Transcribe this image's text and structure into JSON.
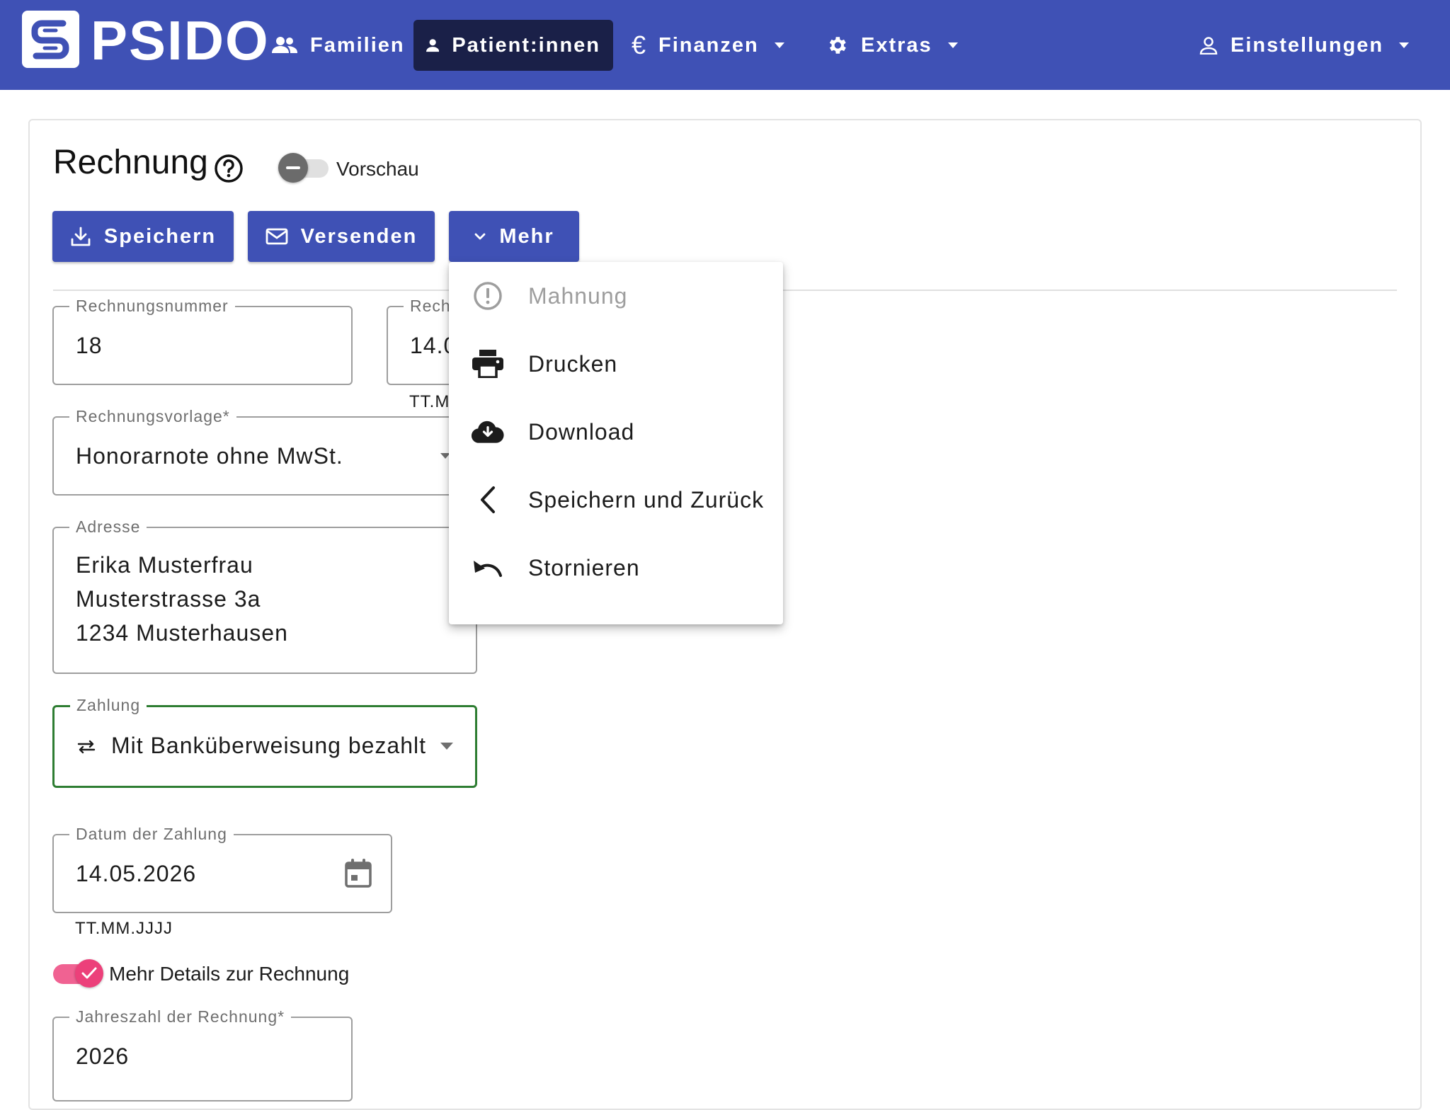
{
  "app": {
    "logo_text": "PSIDO",
    "brand_color": "#3f51b5"
  },
  "nav": {
    "familien": "Familien",
    "patientinnen": "Patient:innen",
    "finanzen": "Finanzen",
    "extras": "Extras",
    "einstellungen": "Einstellungen"
  },
  "page": {
    "title": "Rechnung",
    "preview_label": "Vorschau",
    "buttons": {
      "save": "Speichern",
      "send": "Versenden",
      "more": "Mehr"
    }
  },
  "form": {
    "invoice_number": {
      "label": "Rechnungsnummer",
      "value": "18"
    },
    "invoice_date": {
      "label": "Rech",
      "value": "14.0",
      "helper": "TT.M"
    },
    "template": {
      "label": "Rechnungsvorlage*",
      "value": "Honorarnote ohne MwSt."
    },
    "address": {
      "label": "Adresse",
      "line1": "Erika Musterfrau",
      "line2": "Musterstrasse 3a",
      "line3": "1234 Musterhausen"
    },
    "payment": {
      "label": "Zahlung",
      "value": "Mit Banküberweisung bezahlt",
      "focus_color": "#2e7d32"
    },
    "payment_date": {
      "label": "Datum der Zahlung",
      "value": "14.05.2026",
      "helper": "TT.MM.JJJJ"
    },
    "details_toggle": {
      "label": "Mehr Details zur Rechnung",
      "checked": true
    },
    "year": {
      "label": "Jahreszahl der Rechnung*",
      "value": "2026"
    }
  },
  "menu": {
    "items": [
      {
        "label": "Mahnung",
        "icon": "alert-circle-icon",
        "disabled": true
      },
      {
        "label": "Drucken",
        "icon": "printer-icon",
        "disabled": false
      },
      {
        "label": "Download",
        "icon": "cloud-download-icon",
        "disabled": false
      },
      {
        "label": "Speichern und Zurück",
        "icon": "chevron-left-icon",
        "disabled": false
      },
      {
        "label": "Stornieren",
        "icon": "undo-icon",
        "disabled": false
      }
    ]
  }
}
